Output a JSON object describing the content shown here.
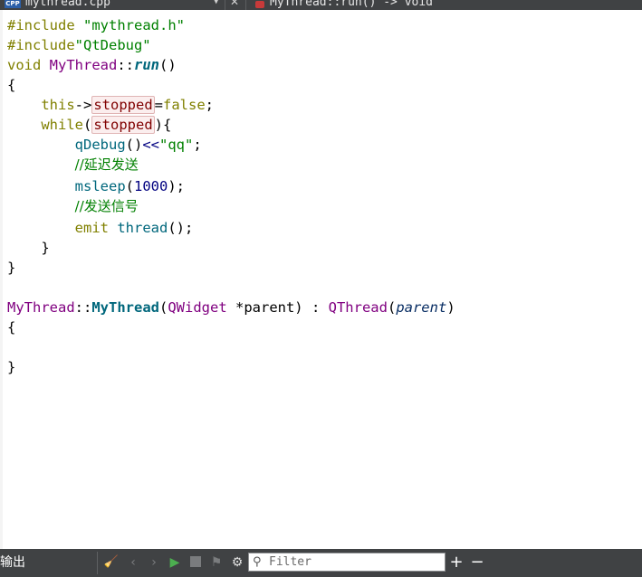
{
  "tabs": {
    "file_badge": "CPP",
    "file_tab": "mythread.cpp",
    "dropdown_icon": "chevron-down-icon",
    "close_icon": "close-icon",
    "symbol_icon": "function-icon",
    "symbol_tab": "MyThread::run() -> void"
  },
  "code": {
    "l1_inc": "#include",
    "l1_str": "\"mythread.h\"",
    "l2_inc": "#include",
    "l2_str": "\"QtDebug\"",
    "l3_void": "void",
    "l3_class": "MyThread",
    "l3_scope": "::",
    "l3_fn": "run",
    "l3_paren": "()",
    "l4": "{",
    "l5_this": "this",
    "l5_arrow": "->",
    "l5_var": "stopped",
    "l5_eq": "=",
    "l5_false": "false",
    "l5_semi": ";",
    "l6_while": "while",
    "l6_open": "(",
    "l6_var": "stopped",
    "l6_close": "){",
    "l7_fn": "qDebug",
    "l7_paren": "()",
    "l7_op": "<<",
    "l7_str": "\"qq\"",
    "l7_semi": ";",
    "l8_comment": "//延迟发送",
    "l9_fn": "msleep",
    "l9_open": "(",
    "l9_num": "1000",
    "l9_close": ");",
    "l10_comment": "//发送信号",
    "l11_emit": "emit",
    "l11_fn": "thread",
    "l11_tail": "();",
    "l12": "}",
    "l13": "}",
    "l15_class": "MyThread",
    "l15_scope": "::",
    "l15_ctor": "MyThread",
    "l15_open": "(",
    "l15_type": "QWidget",
    "l15_param": " *parent) : ",
    "l15_base": "QThread",
    "l15_open2": "(",
    "l15_arg": "parent",
    "l15_close": ")",
    "l16": "{",
    "l18": "}"
  },
  "output_bar": {
    "label": "输出",
    "filter_value": "",
    "filter_placeholder": "Filter",
    "icons": [
      "clean-icon",
      "previous-icon",
      "next-icon",
      "run-icon",
      "stop-icon",
      "attach-icon",
      "gear-icon",
      "search-icon",
      "plus-icon",
      "minus-icon"
    ]
  },
  "colors": {
    "keyword": "#808000",
    "string": "#008000",
    "type": "#800080",
    "function": "#00677c",
    "comment": "#008000",
    "number": "#000080",
    "member": "#800000",
    "bar_bg": "#404244"
  }
}
